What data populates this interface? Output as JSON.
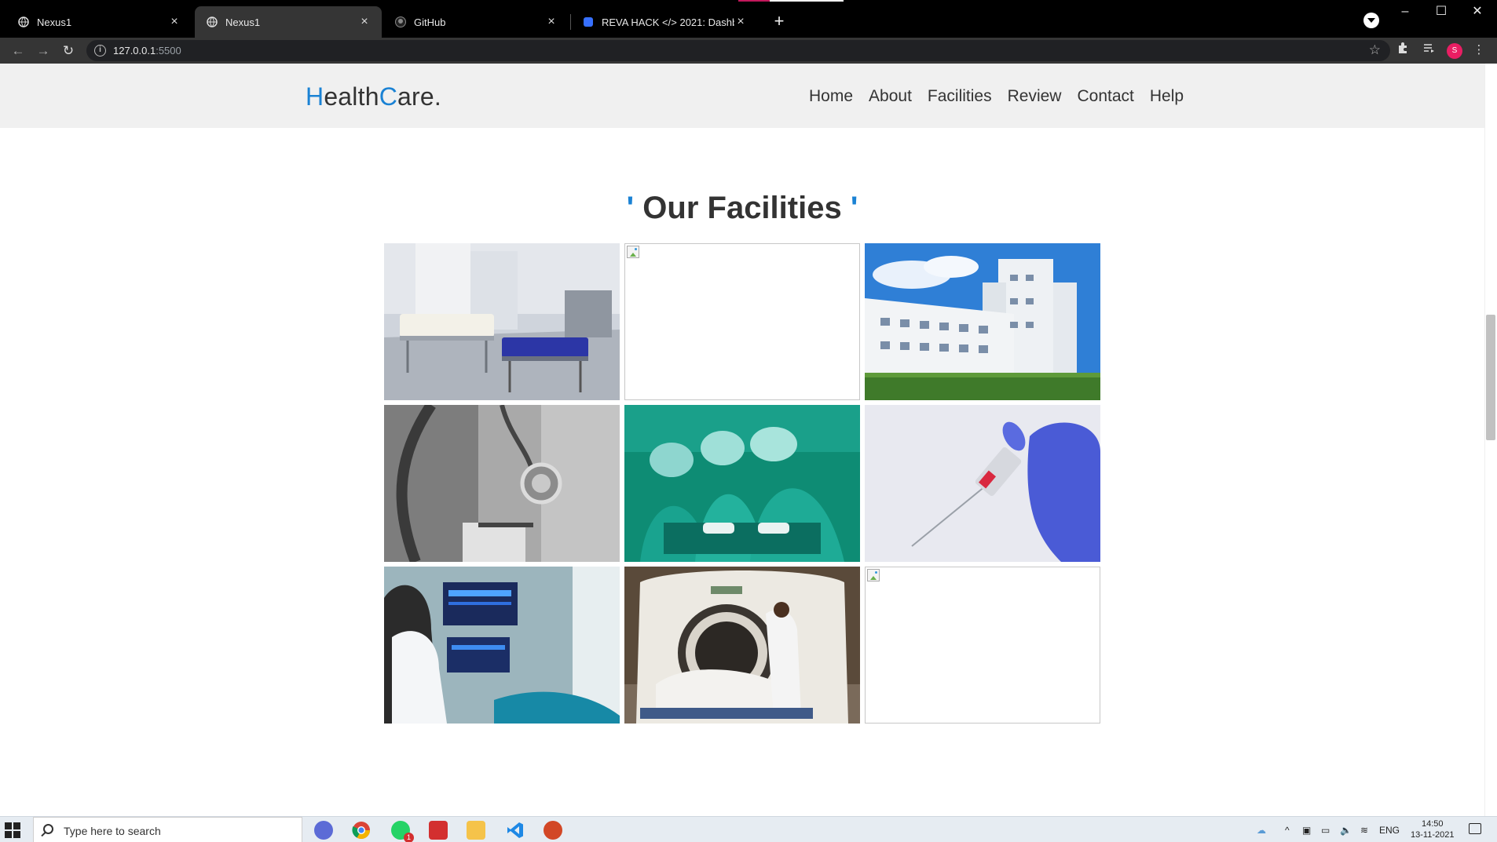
{
  "browser": {
    "tabs": [
      {
        "title": "Nexus1",
        "active": false
      },
      {
        "title": "Nexus1",
        "active": true
      },
      {
        "title": "GitHub",
        "active": false
      },
      {
        "title": "REVA HACK </> 2021: Dashboard",
        "active": false
      }
    ],
    "url_host": "127.0.0.1",
    "url_port": ":5500",
    "profile_initial": "S"
  },
  "site": {
    "logo_first_letter": "H",
    "logo_mid": "ealth",
    "logo_second_letter": "C",
    "logo_end": "are.",
    "nav": [
      "Home",
      "About",
      "Facilities",
      "Review",
      "Contact",
      "Help"
    ],
    "accent_color": "#1a82d4"
  },
  "facilities": {
    "title_quote_open": "'",
    "title": "Our Facilities",
    "title_quote_close": "'",
    "images": [
      {
        "subject": "hospital ward beds",
        "loaded": true
      },
      {
        "subject": "broken image",
        "loaded": false
      },
      {
        "subject": "hospital building",
        "loaded": true
      },
      {
        "subject": "stethoscope",
        "loaded": true
      },
      {
        "subject": "surgery team",
        "loaded": true
      },
      {
        "subject": "syringe in gloved hand",
        "loaded": true
      },
      {
        "subject": "doctor at monitor",
        "loaded": true
      },
      {
        "subject": "CT scanner with patient",
        "loaded": true
      },
      {
        "subject": "broken image",
        "loaded": false
      }
    ]
  },
  "taskbar": {
    "search_placeholder": "Type here to search",
    "language": "ENG",
    "time": "14:50",
    "date": "13-11-2021",
    "whatsapp_badge": "1"
  }
}
